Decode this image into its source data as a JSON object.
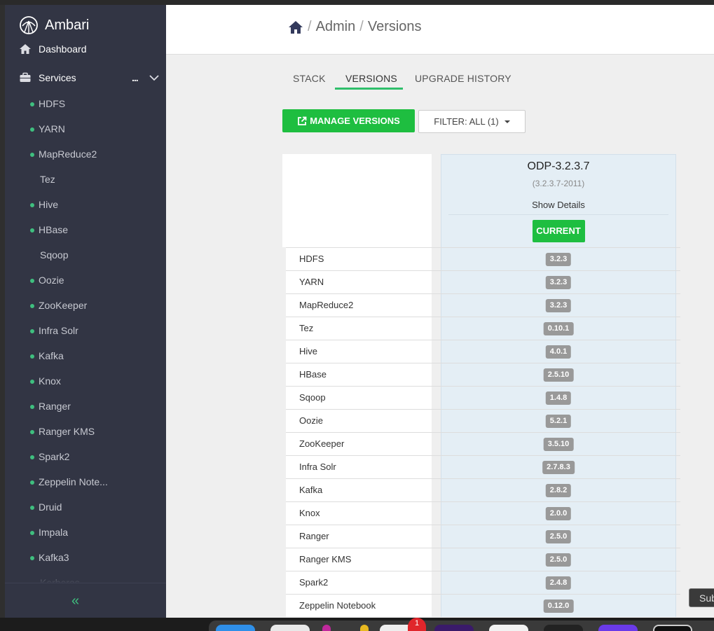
{
  "app": {
    "name": "Ambari"
  },
  "nav": {
    "dashboard_label": "Dashboard",
    "services_label": "Services",
    "more_label": "..."
  },
  "services": [
    {
      "label": "HDFS",
      "status": "started"
    },
    {
      "label": "YARN",
      "status": "started"
    },
    {
      "label": "MapReduce2",
      "status": "started"
    },
    {
      "label": "Tez",
      "status": "client-only"
    },
    {
      "label": "Hive",
      "status": "started"
    },
    {
      "label": "HBase",
      "status": "started"
    },
    {
      "label": "Sqoop",
      "status": "client-only"
    },
    {
      "label": "Oozie",
      "status": "started"
    },
    {
      "label": "ZooKeeper",
      "status": "started"
    },
    {
      "label": "Infra Solr",
      "status": "started"
    },
    {
      "label": "Kafka",
      "status": "started"
    },
    {
      "label": "Knox",
      "status": "started"
    },
    {
      "label": "Ranger",
      "status": "started"
    },
    {
      "label": "Ranger KMS",
      "status": "started"
    },
    {
      "label": "Spark2",
      "status": "started"
    },
    {
      "label": "Zeppelin Note...",
      "status": "started"
    },
    {
      "label": "Druid",
      "status": "started"
    },
    {
      "label": "Impala",
      "status": "started"
    },
    {
      "label": "Kafka3",
      "status": "started"
    },
    {
      "label": "Kerberos",
      "status": "client-only"
    }
  ],
  "sidebar_footer": {
    "collapse_label": "«"
  },
  "breadcrumb": {
    "admin": "Admin",
    "versions": "Versions",
    "separator": "/"
  },
  "tabs": {
    "stack": "STACK",
    "versions": "VERSIONS",
    "upgrade_history": "UPGRADE HISTORY",
    "active": "VERSIONS"
  },
  "actions": {
    "manage_versions": "MANAGE VERSIONS",
    "filter": "FILTER: ALL (1)"
  },
  "version": {
    "name": "ODP-3.2.3.7",
    "build": "(3.2.3.7-2011)",
    "show_details": "Show Details",
    "state": "CURRENT"
  },
  "components": [
    {
      "name": "HDFS",
      "version": "3.2.3"
    },
    {
      "name": "YARN",
      "version": "3.2.3"
    },
    {
      "name": "MapReduce2",
      "version": "3.2.3"
    },
    {
      "name": "Tez",
      "version": "0.10.1"
    },
    {
      "name": "Hive",
      "version": "4.0.1"
    },
    {
      "name": "HBase",
      "version": "2.5.10"
    },
    {
      "name": "Sqoop",
      "version": "1.4.8"
    },
    {
      "name": "Oozie",
      "version": "5.2.1"
    },
    {
      "name": "ZooKeeper",
      "version": "3.5.10"
    },
    {
      "name": "Infra Solr",
      "version": "2.7.8.3"
    },
    {
      "name": "Kafka",
      "version": "2.8.2"
    },
    {
      "name": "Knox",
      "version": "2.0.0"
    },
    {
      "name": "Ranger",
      "version": "2.5.0"
    },
    {
      "name": "Ranger KMS",
      "version": "2.5.0"
    },
    {
      "name": "Spark2",
      "version": "2.4.8"
    },
    {
      "name": "Zeppelin Notebook",
      "version": "0.12.0"
    }
  ],
  "overlay": {
    "submit_label": "Sub"
  },
  "dock": {
    "notification_count": "1"
  },
  "colors": {
    "sidebar_bg": "#323544",
    "accent_green": "#1ebe40",
    "status_dot": "#3fbf7f",
    "version_col_bg": "#e4eef5",
    "badge_bg": "#999999"
  }
}
